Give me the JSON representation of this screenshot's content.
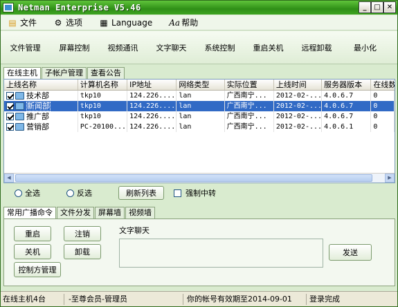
{
  "window": {
    "title": "Netman Enterprise V5.46"
  },
  "menu": [
    {
      "label": "文件",
      "icon": "folder-icon"
    },
    {
      "label": "选项",
      "icon": "options-icon"
    },
    {
      "label": "Language",
      "icon": "language-icon"
    },
    {
      "label": "帮助",
      "icon": "help-icon"
    }
  ],
  "toolbar": [
    "文件管理",
    "屏幕控制",
    "视频通讯",
    "文字聊天",
    "系统控制",
    "重启关机",
    "远程卸载",
    "最小化"
  ],
  "tabs": [
    "在线主机",
    "子帐户管理",
    "查看公告"
  ],
  "table": {
    "headers": [
      "上线名称",
      "计算机名称",
      "IP地址",
      "网络类型",
      "实际位置",
      "上线时间",
      "服务器版本",
      "在线数"
    ],
    "rows": [
      [
        "技术部",
        "tkp10",
        "124.226....",
        "lan",
        "广西南宁...",
        "2012-02-...",
        "4.0.6.7",
        "0"
      ],
      [
        "新闻部",
        "tkp10",
        "124.226....",
        "lan",
        "广西南宁...",
        "2012-02-...",
        "4.0.6.7",
        "0"
      ],
      [
        "推广部",
        "tkp10",
        "124.226....",
        "lan",
        "广西南宁...",
        "2012-02-...",
        "4.0.6.7",
        "0"
      ],
      [
        "营销部",
        "PC-20100...",
        "124.226....",
        "lan",
        "广西南宁...",
        "2012-02-...",
        "4.0.6.1",
        "0"
      ]
    ],
    "selected_row": 1
  },
  "options": {
    "select_all": "全选",
    "invert": "反选",
    "refresh": "刷新列表",
    "force_relay": "强制中转"
  },
  "bottom_tabs": [
    "常用广播命令",
    "文件分发",
    "屏幕墙",
    "视频墙"
  ],
  "commands": {
    "restart": "重启",
    "logout": "注销",
    "shutdown": "关机",
    "uninstall": "卸载",
    "controller": "控制方管理"
  },
  "chat": {
    "label": "文字聊天",
    "send": "发送"
  },
  "status": [
    "在线主机4台",
    "-至尊会员-管理员",
    "你的帐号有效期至2014-09-01",
    "登录完成"
  ]
}
